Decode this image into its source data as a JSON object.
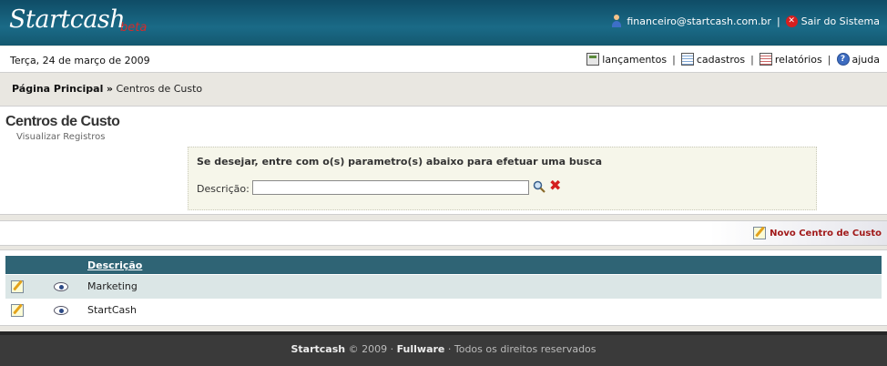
{
  "header": {
    "logo": "Startcash",
    "beta": "beta",
    "user_email": "financeiro@startcash.com.br",
    "separator": "|",
    "logout_label": "Sair do Sistema"
  },
  "datebar": {
    "date": "Terça, 24 de março de 2009",
    "nav": [
      {
        "label": "lançamentos",
        "icon": "calculator-icon"
      },
      {
        "label": "cadastros",
        "icon": "table-icon"
      },
      {
        "label": "relatórios",
        "icon": "report-icon"
      },
      {
        "label": "ajuda",
        "icon": "help-icon"
      }
    ],
    "pipe": "|"
  },
  "breadcrumb": {
    "home": "Página Principal",
    "arrow": "»",
    "current": "Centros de Custo"
  },
  "panel": {
    "title": "Centros de Custo",
    "subtitle": "Visualizar Registros",
    "search_hint": "Se desejar, entre com o(s) parametro(s) abaixo para efetuar uma busca",
    "field_label": "Descrição:",
    "field_value": ""
  },
  "actions": {
    "new_label": "Novo Centro de Custo"
  },
  "table": {
    "header": "Descrição",
    "rows": [
      "Marketing",
      "StartCash"
    ]
  },
  "footer": {
    "brand": "Startcash",
    "copy": "© 2009 ·",
    "company": "Fullware",
    "rights": "· Todos os direitos reservados"
  },
  "colors": {
    "header_bg": "#14586f",
    "table_header": "#2f6475",
    "accent_red": "#a11919"
  }
}
